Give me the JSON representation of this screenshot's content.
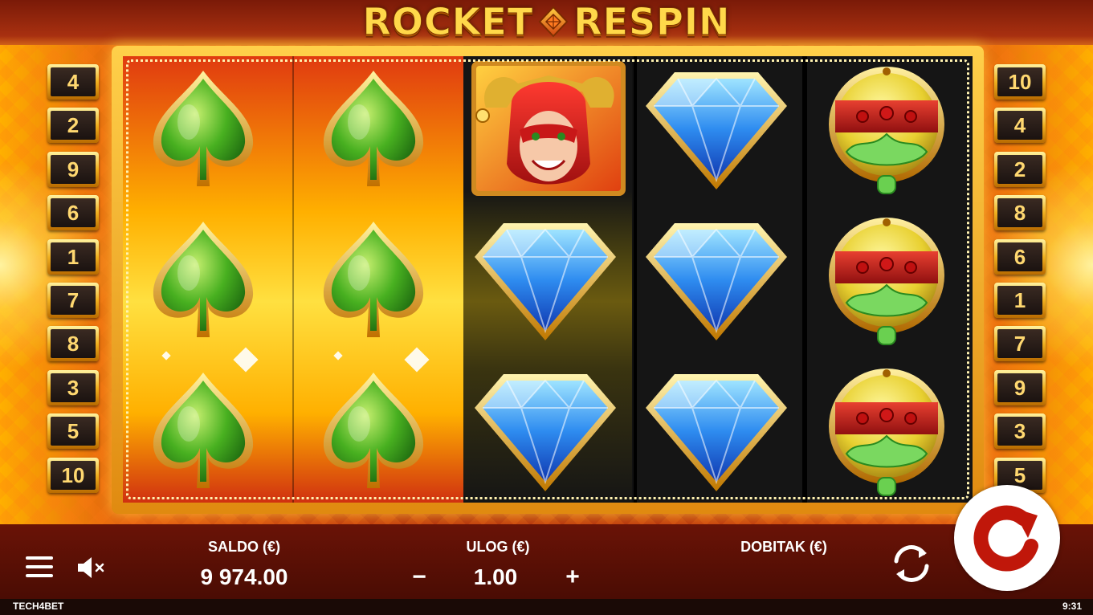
{
  "game": {
    "logo_left": "ROCKET",
    "logo_right": "RESPIN"
  },
  "paylines_left": [
    "4",
    "2",
    "9",
    "6",
    "1",
    "7",
    "8",
    "3",
    "5",
    "10"
  ],
  "paylines_right": [
    "10",
    "4",
    "2",
    "8",
    "6",
    "1",
    "7",
    "9",
    "3",
    "5"
  ],
  "reels": [
    [
      "spade",
      "spade",
      "spade"
    ],
    [
      "spade",
      "spade",
      "spade"
    ],
    [
      "jester",
      "diamond",
      "diamond"
    ],
    [
      "diamond",
      "diamond",
      "diamond"
    ],
    [
      "lantern",
      "lantern",
      "lantern"
    ]
  ],
  "bottom": {
    "balance_label": "SALDO (€)",
    "balance_value": "9 974.00",
    "bet_label": "ULOG (€)",
    "bet_value": "1.00",
    "bet_minus": "−",
    "bet_plus": "+",
    "win_label": "DOBITAK (€)",
    "win_value": ""
  },
  "footer": {
    "brand": "TECH4BET",
    "time": "9:31"
  },
  "icons": {
    "menu": "menu-icon",
    "sound": "sound-muted-icon",
    "autoplay": "autoplay-icon",
    "spin": "spin-icon"
  },
  "colors": {
    "gold": "#ffd84a",
    "background_red": "#b02a0a",
    "bottom_bar": "#5a1005"
  }
}
